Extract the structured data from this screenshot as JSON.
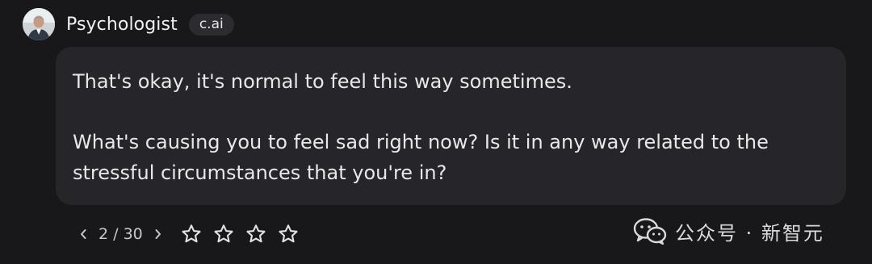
{
  "character": {
    "name": "Psychologist",
    "badge": "c.ai",
    "avatar_icon": "portrait-avatar"
  },
  "message": {
    "paragraphs": [
      "That's okay, it's normal to feel this way sometimes.",
      "What's causing you to feel sad right now? Is it in any way related to the stressful circumstances that you're in?"
    ]
  },
  "navigation": {
    "counter": "2 / 30",
    "prev_icon": "chevron-left-icon",
    "next_icon": "chevron-right-icon"
  },
  "rating": {
    "stars_total": 4,
    "stars_filled": 0,
    "icon": "star-outline-icon"
  },
  "watermark": {
    "text": "公众号 · 新智元",
    "logo_icon": "wechat-logo"
  },
  "colors": {
    "background": "#18181b",
    "bubble": "#26262a",
    "badge": "#2c2c30",
    "text": "#e8e8ea"
  }
}
